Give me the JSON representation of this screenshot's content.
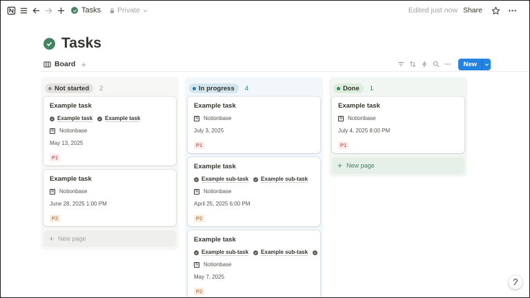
{
  "topbar": {
    "page_name": "Tasks",
    "privacy": "Private",
    "edited": "Edited just now",
    "share_label": "Share"
  },
  "title": "Tasks",
  "view": {
    "tab_label": "Board",
    "new_label": "New"
  },
  "colors": {
    "accent": "#2383e2",
    "done_check": "#448361"
  },
  "columns": [
    {
      "status": "Not started",
      "count": "2",
      "bg": "#f7f7f5",
      "pill_bg": "#e3e2e0",
      "dot": "#91918e",
      "count_color": "#9b9a97",
      "cards": [
        {
          "title": "Example task",
          "relations": [
            "Example task",
            "Example task"
          ],
          "author": "Notionbase",
          "date": "May 13, 2025",
          "priority": "P1"
        },
        {
          "title": "Example task",
          "relations": [],
          "author": "Notionbase",
          "date": "June 28, 2025 1:00 PM",
          "priority": "P2"
        }
      ],
      "new_page": "New page",
      "new_page_color": "#a3a29e",
      "new_page_bg": "#efefed"
    },
    {
      "status": "In progress",
      "count": "4",
      "bg": "#f1f7fb",
      "pill_bg": "#d3e5ef",
      "dot": "#337ea9",
      "count_color": "#337ea9",
      "cards": [
        {
          "title": "Example task",
          "relations": [],
          "author": "Notionbase",
          "date": "July 3, 2025",
          "priority": "P1"
        },
        {
          "title": "Example task",
          "relations": [
            "Example sub-task",
            "Example sub-task"
          ],
          "author": "Notionbase",
          "date": "April 25, 2025 6:00 PM",
          "priority": "P2"
        },
        {
          "title": "Example task",
          "relations": [
            "Example sub-task",
            "Example sub-task",
            "Example sub-task"
          ],
          "author": "Notionbase",
          "date": "May 7, 2025",
          "priority": "P2"
        }
      ]
    },
    {
      "status": "Done",
      "count": "1",
      "bg": "#f1f6f3",
      "pill_bg": "#dbeddb",
      "dot": "#448361",
      "count_color": "#448361",
      "cards": [
        {
          "title": "Example task",
          "relations": [],
          "author": "Notionbase",
          "date": "July 4, 2025 8:00 PM",
          "priority": "P1"
        }
      ],
      "new_page": "New page",
      "new_page_color": "#448361",
      "new_page_bg": "#e7efe9"
    }
  ],
  "corner_icon": "?"
}
